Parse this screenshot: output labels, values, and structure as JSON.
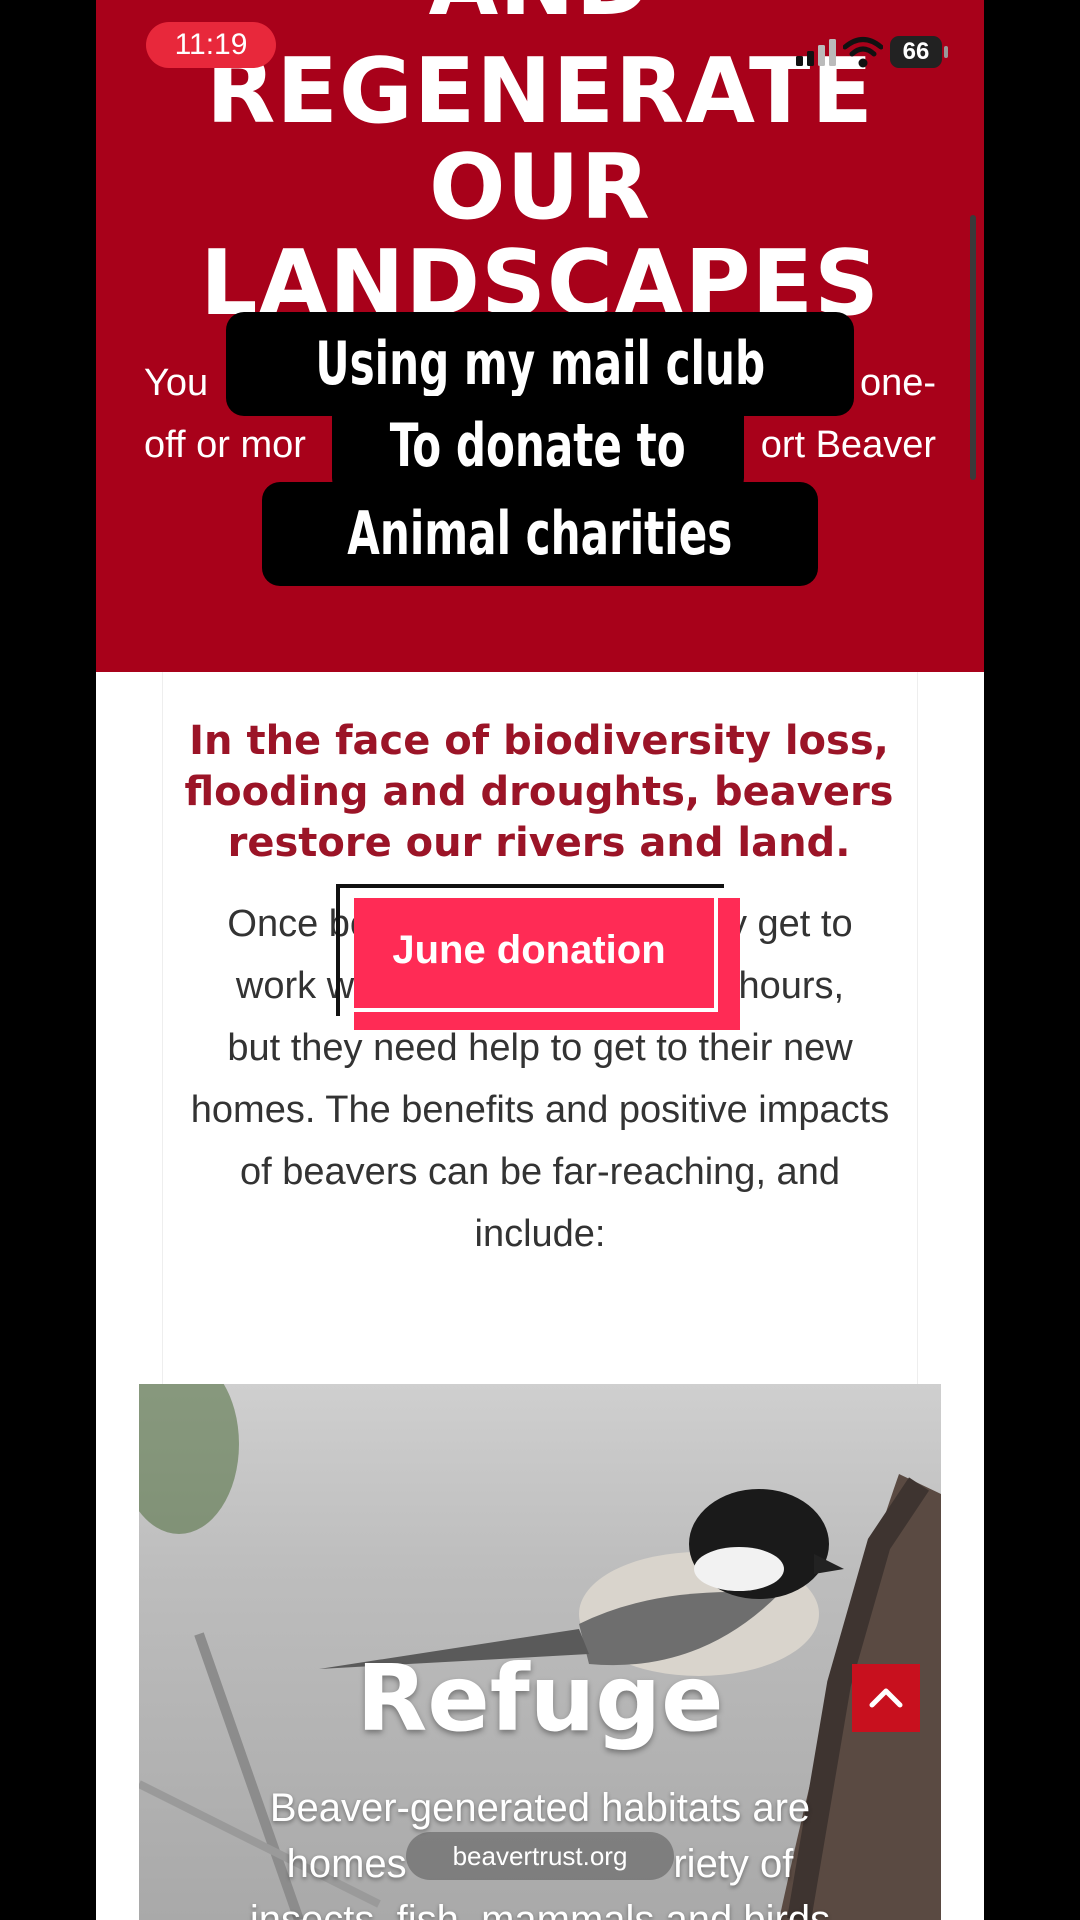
{
  "status_bar": {
    "time": "11:19",
    "battery": "66"
  },
  "hero": {
    "title_lines": [
      "AND",
      "REGENERATE",
      "OUR",
      "LANDSCAPES"
    ],
    "body_rows": [
      {
        "left": "You",
        "right": "one-"
      },
      {
        "left": "off or mor",
        "right": "ort Beaver"
      }
    ]
  },
  "overlay_caption": {
    "line1": "Using my mail club",
    "line2": "To donate to",
    "line3": "Animal charities"
  },
  "content": {
    "lead": "In the face of biodiversity loss, flooding and droughts, beavers restore our rivers and land.",
    "body_lines": [
      "Once beav                          hey get to",
      "work withi                         ven hours,",
      "but they need help to get to their new",
      "homes. The benefits and positive impacts",
      "of beavers can be far-reaching, and",
      "include:"
    ]
  },
  "sticker": {
    "label": "June donation"
  },
  "feature_card": {
    "title": "Refuge",
    "text_lines": [
      "Beaver-generated habitats are",
      "homes                        riety of",
      "insects, fish, mammals and birds"
    ]
  },
  "address_bar": {
    "url": "beavertrust.org"
  },
  "colors": {
    "hero_red": "#a8011a",
    "lead_red": "#9b1427",
    "sticker_pink": "#ff2b55",
    "time_pill": "#e8283b",
    "back_to_top": "#c8101e"
  },
  "icons": {
    "back_to_top": "chevron-up-icon",
    "signal": "cellular-signal-icon",
    "wifi": "wifi-icon",
    "battery": "battery-icon"
  }
}
